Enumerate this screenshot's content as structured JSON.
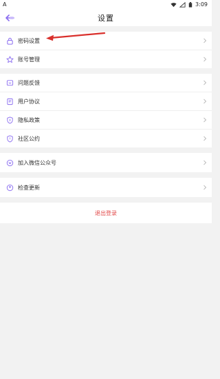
{
  "status_bar": {
    "left_label": "A",
    "time": "3:09"
  },
  "header": {
    "title": "设置"
  },
  "groups": [
    {
      "items": [
        {
          "label": "密码设置",
          "icon": "lock-icon"
        },
        {
          "label": "账号管理",
          "icon": "star-icon"
        }
      ]
    },
    {
      "items": [
        {
          "label": "问题反馈",
          "icon": "message-icon"
        },
        {
          "label": "用户协议",
          "icon": "document-icon"
        },
        {
          "label": "隐私政策",
          "icon": "shield-icon"
        },
        {
          "label": "社区公约",
          "icon": "shield-check-icon"
        }
      ]
    },
    {
      "items": [
        {
          "label": "加入微信公众号",
          "icon": "wechat-icon"
        }
      ]
    },
    {
      "items": [
        {
          "label": "检查更新",
          "icon": "update-icon"
        }
      ]
    }
  ],
  "logout": {
    "label": "退出登录"
  },
  "colors": {
    "accent": "#8a6cf0",
    "logout": "#e24a4a",
    "annotation_arrow": "#d9302c"
  }
}
